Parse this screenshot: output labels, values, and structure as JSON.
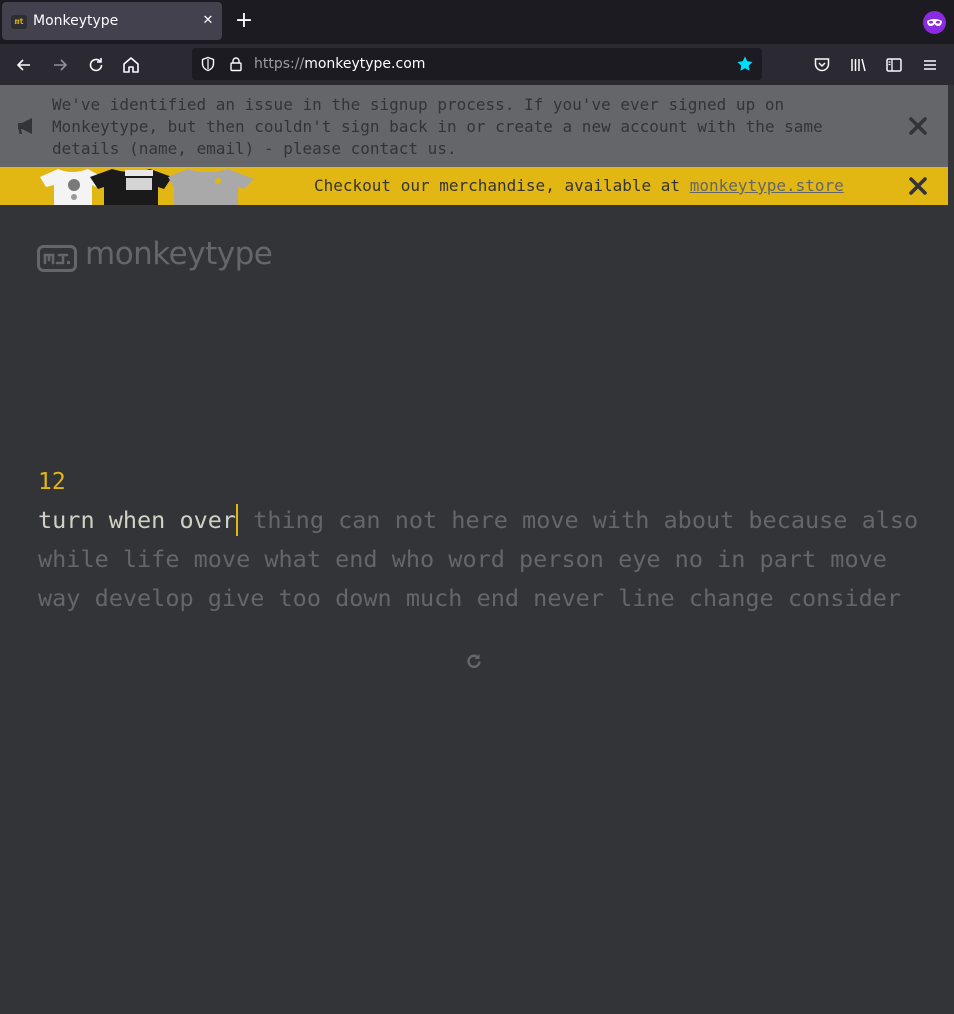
{
  "browser": {
    "tab_title": "Monkeytype",
    "favicon_text": "mt",
    "tab_close": "✕",
    "new_tab": "+",
    "url_protocol": "https://",
    "url_domain": "monkeytype.com"
  },
  "notice": {
    "text": "We've identified an issue in the signup process. If you've ever signed up on\nMonkeytype, but then couldn't sign back in or create a new account with the same\ndetails (name, email) - please contact us."
  },
  "merch": {
    "text": "Checkout our merchandise, available at ",
    "link": "monkeytype.store"
  },
  "app": {
    "logo": "monkeytype",
    "word_count": "12",
    "typed_words": "turn when over",
    "line1_rest": " thing can not here move with about because also",
    "line2": "while life move what end who word person eye no in part move",
    "line3": "way develop give too down much end never line change consider"
  },
  "colors": {
    "background": "#323437",
    "accent": "#e2b714",
    "text_dim": "#646669",
    "text_typed": "#d1d0c5"
  }
}
